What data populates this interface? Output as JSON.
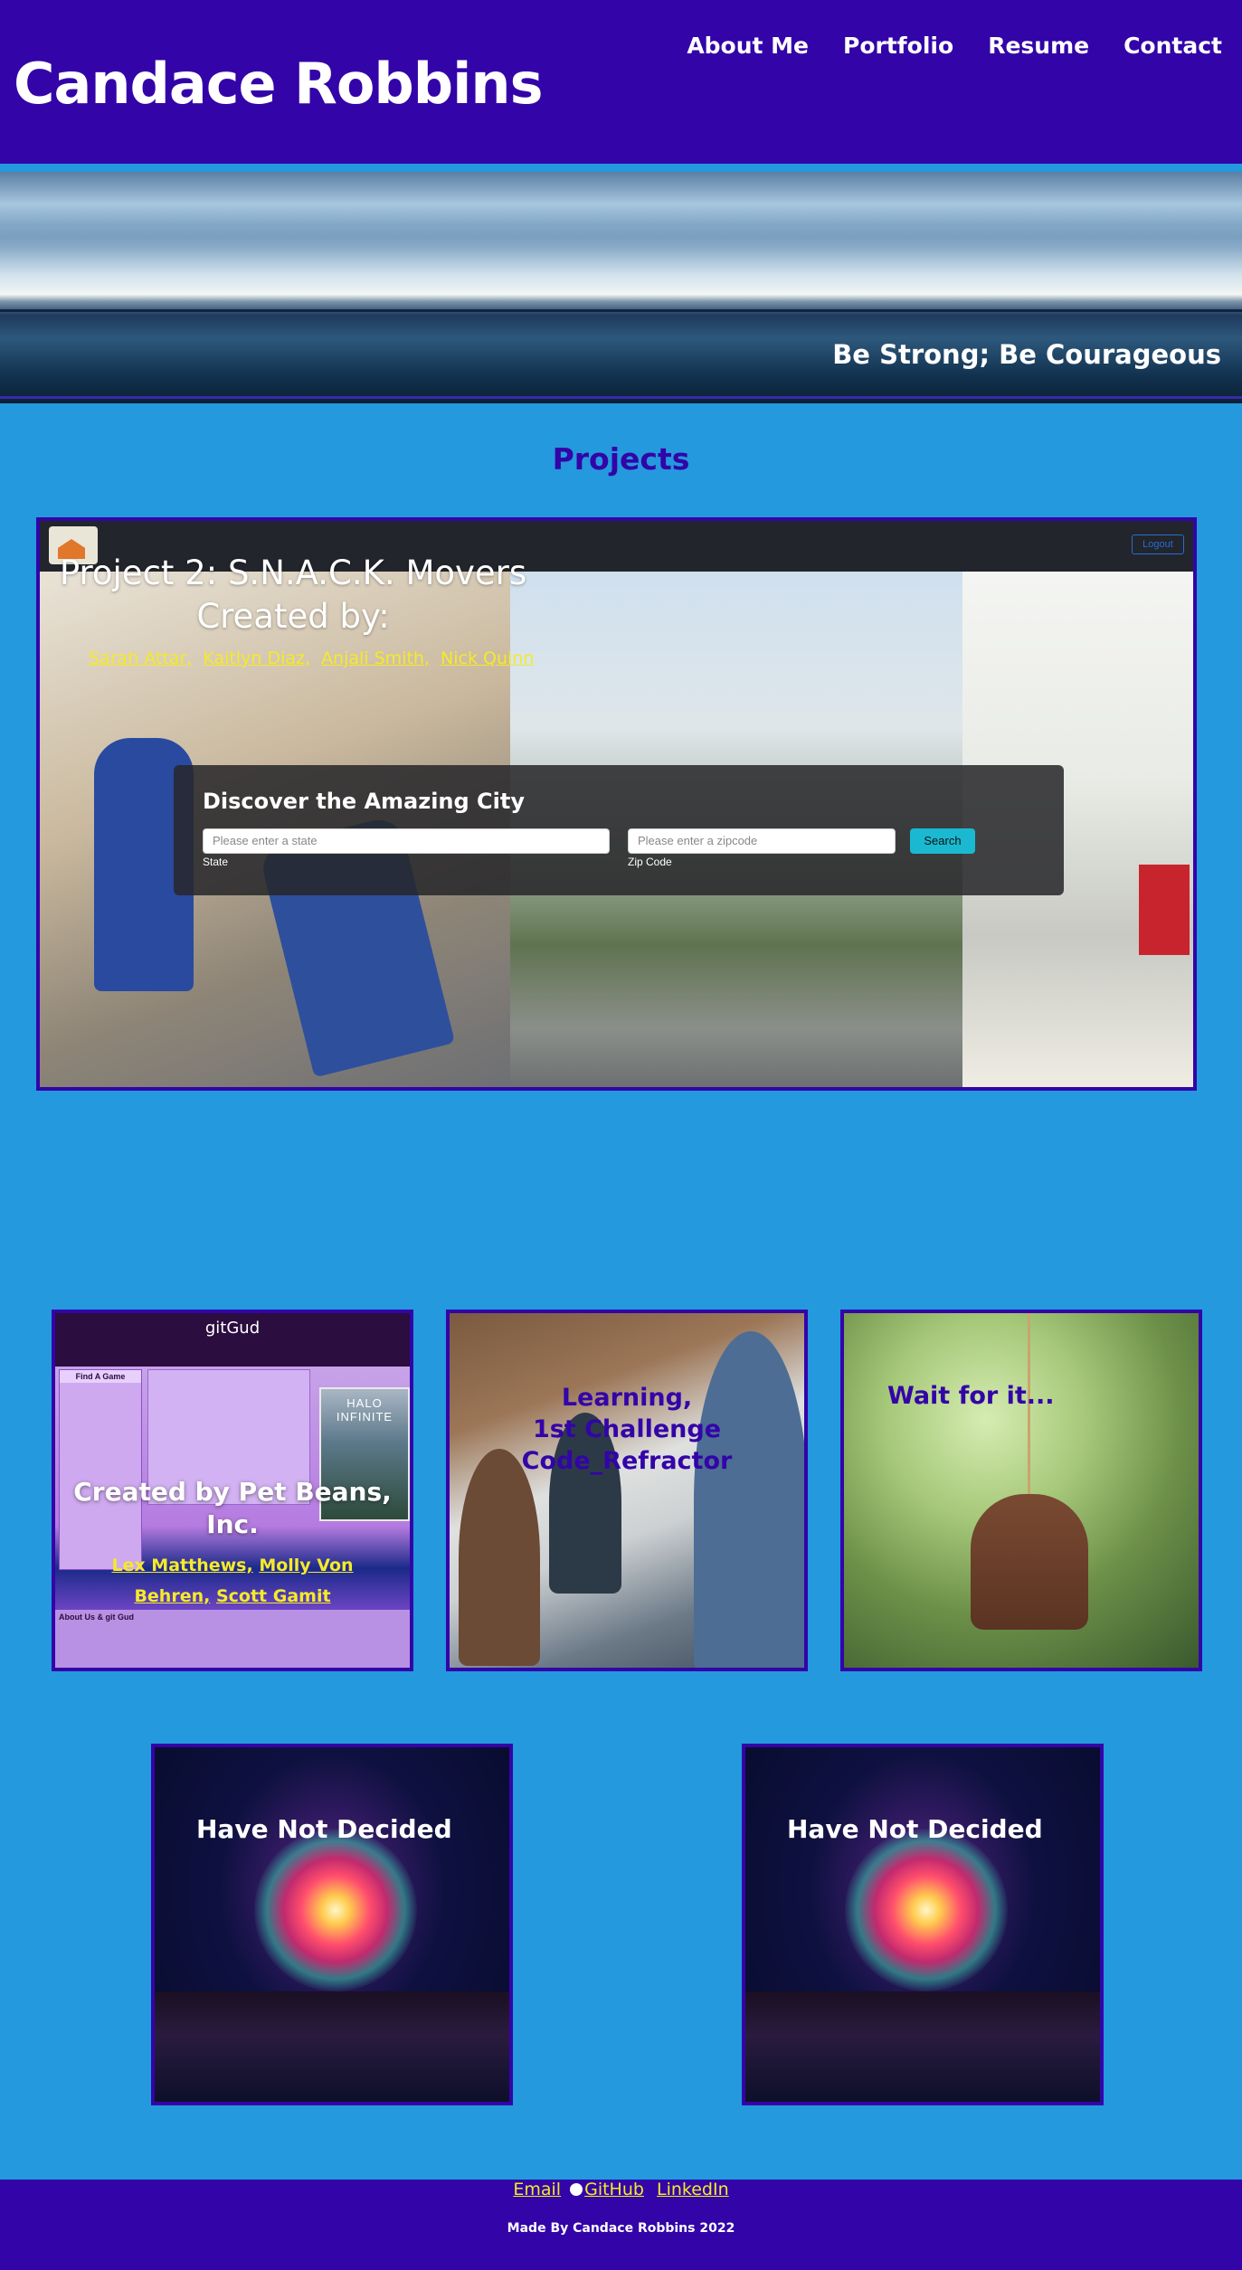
{
  "header": {
    "site_title": "Candace Robbins",
    "nav": [
      "About Me",
      "Portfolio",
      "Resume",
      "Contact"
    ]
  },
  "hero": {
    "quote": "Be Strong; Be Courageous"
  },
  "projects": {
    "section_title": "Projects",
    "featured": {
      "title_line1": "Project 2: S.N.A.C.K. Movers",
      "title_line2": "Created by:",
      "authors": [
        "Sarah Attar,",
        "Kaitlyn Diaz,",
        "Anjali Smith,",
        "Nick Quinn"
      ],
      "logout_label": "Logout",
      "search_title": "Discover the Amazing City",
      "state_placeholder": "Please enter a state",
      "zip_placeholder": "Please enter a zipcode",
      "search_button": "Search",
      "state_label": "State",
      "zip_label": "Zip Code"
    },
    "cards": [
      {
        "title": "Created by Pet Beans, Inc.",
        "authors_line1": [
          "Lex Matthews,",
          "Molly Von"
        ],
        "authors_line2": [
          "Behren,",
          "Scott Gamit"
        ],
        "screenshot_title": "gitGud",
        "sidebar_heading": "Find A Game",
        "cover_title": "HALO INFINITE",
        "about_heading": "About Us & git Gud"
      },
      {
        "title_line1": "Learning,",
        "title_line2": "1st Challenge",
        "title_line3": "Code_Refractor"
      },
      {
        "title": "Wait for it..."
      },
      {
        "title": "Have Not Decided"
      },
      {
        "title": "Have Not Decided"
      }
    ]
  },
  "footer": {
    "links": [
      "Email",
      "GitHub",
      "LinkedIn"
    ],
    "copyright": "Made By Candace Robbins 2022"
  }
}
